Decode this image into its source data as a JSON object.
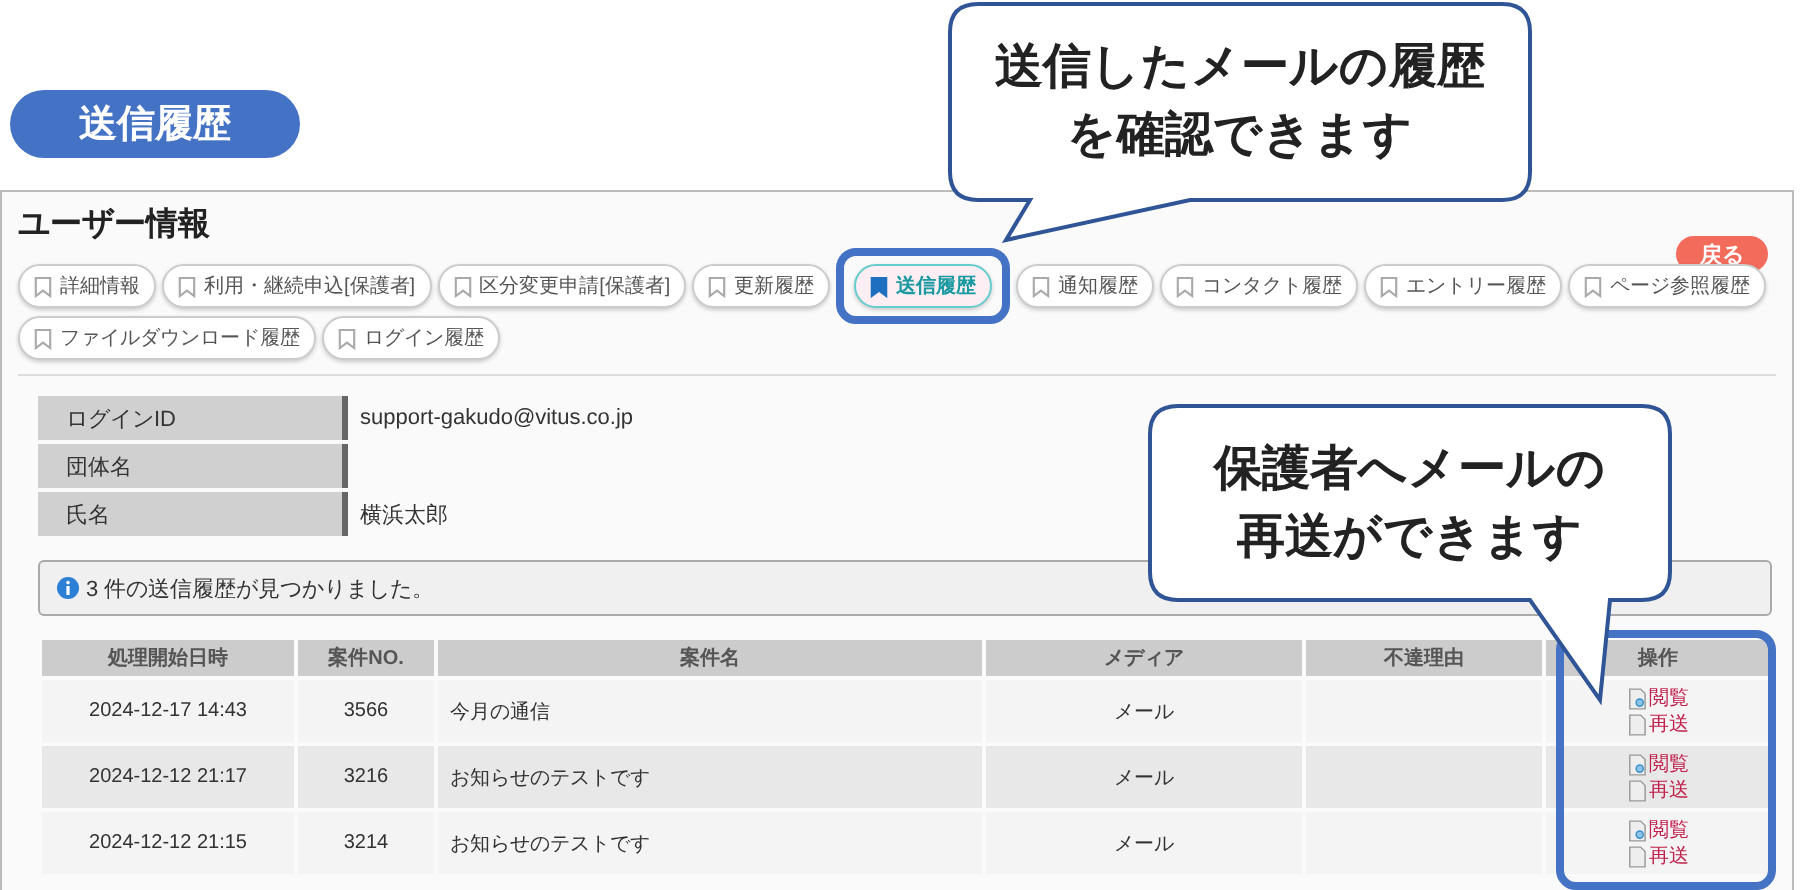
{
  "badge": {
    "title": "送信履歴"
  },
  "panel": {
    "title": "ユーザー情報",
    "back_button": "戻る"
  },
  "tab_rows": [
    [
      {
        "label": "詳細情報",
        "selected": false
      },
      {
        "label": "利用・継続申込[保護者]",
        "selected": false
      },
      {
        "label": "区分変更申請[保護者]",
        "selected": false
      },
      {
        "label": "更新履歴",
        "selected": false
      },
      {
        "label": "送信履歴",
        "selected": true
      },
      {
        "label": "通知履歴",
        "selected": false
      },
      {
        "label": "コンタクト履歴",
        "selected": false
      },
      {
        "label": "エントリー履歴",
        "selected": false
      },
      {
        "label": "ページ参照履歴",
        "selected": false
      }
    ],
    [
      {
        "label": "ファイルダウンロード履歴",
        "selected": false
      },
      {
        "label": "ログイン履歴",
        "selected": false
      }
    ]
  ],
  "info": [
    {
      "label": "ログインID",
      "value": "support-gakudo@vitus.co.jp"
    },
    {
      "label": "団体名"
    },
    {
      "label": "氏名",
      "value": "横浜太郎"
    }
  ],
  "notice": "3 件の送信履歴が見つかりました。",
  "table": {
    "columns": [
      "処理開始日時",
      "案件NO.",
      "案件名",
      "メディア",
      "不達理由",
      "操作"
    ],
    "rows": [
      {
        "date": "2024-12-17 14:43",
        "number": "3566",
        "subject": "今月の通信",
        "media": "メール",
        "actions": [
          "閲覧",
          "再送"
        ]
      },
      {
        "date": "2024-12-12 21:17",
        "number": "3216",
        "subject": "お知らせのテストです",
        "media": "メール",
        "actions": [
          "閲覧",
          "再送"
        ]
      },
      {
        "date": "2024-12-12 21:15",
        "number": "3214",
        "subject": "お知らせのテストです",
        "media": "メール",
        "actions": [
          "閲覧",
          "再送"
        ]
      }
    ]
  },
  "callouts": [
    {
      "lines": [
        "送信したメールの履歴",
        "を確認できます"
      ]
    },
    {
      "lines": [
        "保護者へメールの",
        "再送ができます"
      ]
    }
  ]
}
